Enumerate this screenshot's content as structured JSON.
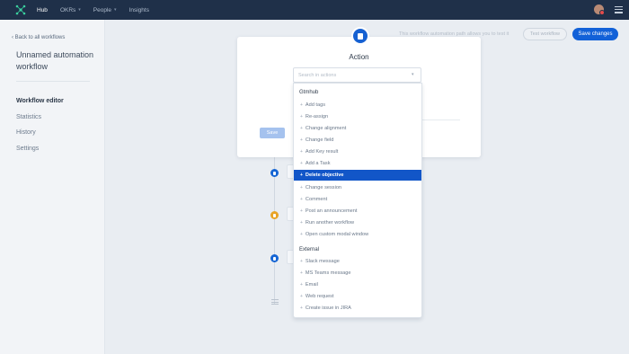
{
  "nav": {
    "items": [
      {
        "label": "Hub",
        "active": true
      },
      {
        "label": "OKRs",
        "dropdown": true
      },
      {
        "label": "People",
        "dropdown": true
      },
      {
        "label": "Insights"
      }
    ]
  },
  "sidebar": {
    "back_label": "‹ Back to all workflows",
    "title": "Unnamed automation workflow",
    "items": [
      {
        "label": "Workflow editor",
        "active": true
      },
      {
        "label": "Statistics"
      },
      {
        "label": "History"
      },
      {
        "label": "Settings"
      }
    ]
  },
  "header": {
    "hint": "This workflow automation path allows you to test it",
    "test_label": "Test workflow",
    "save_label": "Save changes"
  },
  "modal": {
    "title": "Action",
    "save_label": "Save"
  },
  "search": {
    "placeholder": "Search in actions"
  },
  "dropdown": {
    "groups": [
      {
        "label": "Gtmhub",
        "items": [
          "Add tags",
          "Re-assign",
          "Change alignment",
          "Change field",
          "Add Key result",
          "Add a Task",
          "Delete objective",
          "Change session",
          "Comment",
          "Post an announcement",
          "Run another workflow",
          "Open custom modal window"
        ]
      },
      {
        "label": "External",
        "items": [
          "Slack message",
          "MS Teams message",
          "Email",
          "Web request",
          "Create issue in JIRA"
        ]
      }
    ],
    "selected": "Delete objective"
  },
  "colors": {
    "nav_bg": "#1f3049",
    "accent": "#1261d8",
    "selected": "#1256c8",
    "warning_node": "#e8a326"
  }
}
